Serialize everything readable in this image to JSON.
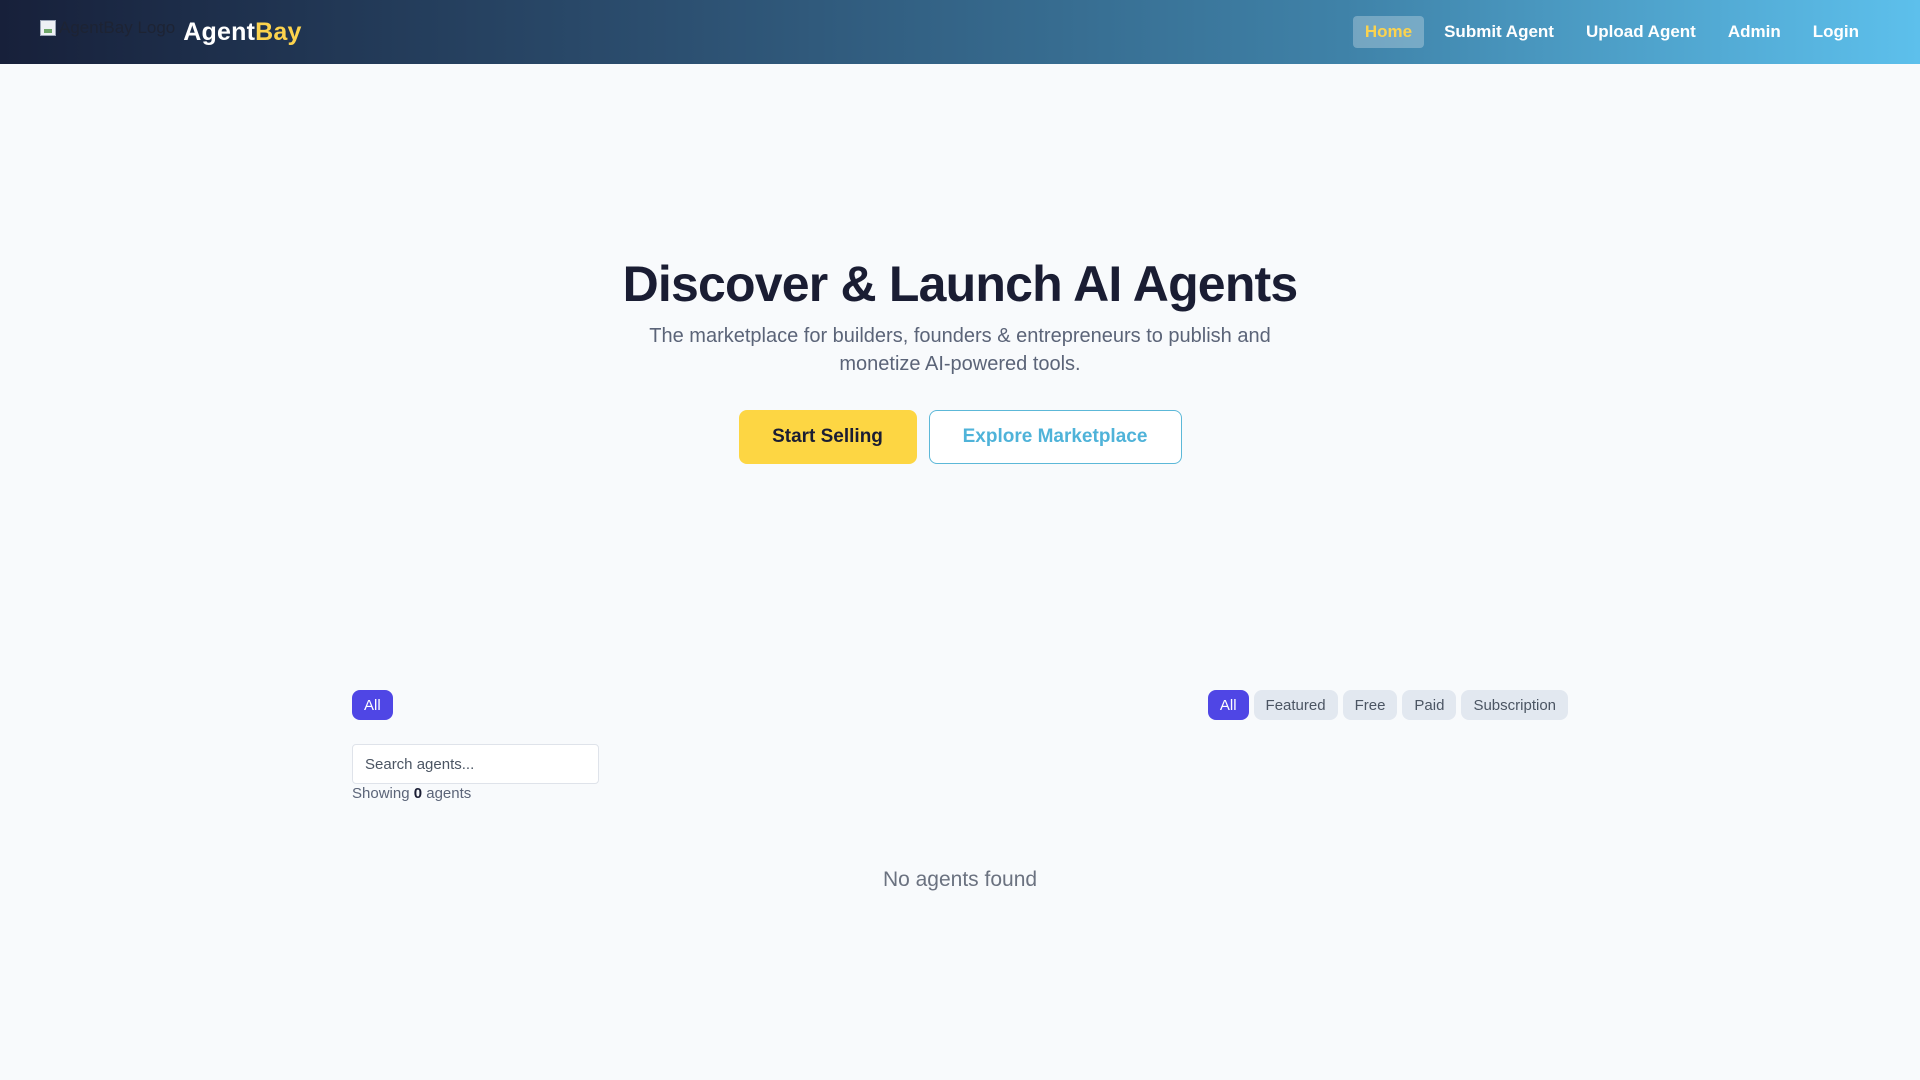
{
  "header": {
    "logo_alt": "AgentBay Logo",
    "brand_primary": "Agent",
    "brand_accent": "Bay",
    "nav": [
      {
        "label": "Home",
        "active": true
      },
      {
        "label": "Submit Agent",
        "active": false
      },
      {
        "label": "Upload Agent",
        "active": false
      },
      {
        "label": "Admin",
        "active": false
      },
      {
        "label": "Login",
        "active": false
      }
    ]
  },
  "hero": {
    "title": "Discover & Launch AI Agents",
    "subtitle": "The marketplace for builders, founders & entrepreneurs to publish and monetize AI-powered tools.",
    "primary_cta": "Start Selling",
    "secondary_cta": "Explore Marketplace"
  },
  "filters": {
    "categories": [
      {
        "label": "All",
        "active": true
      }
    ],
    "types": [
      {
        "label": "All",
        "active": true
      },
      {
        "label": "Featured",
        "active": false
      },
      {
        "label": "Free",
        "active": false
      },
      {
        "label": "Paid",
        "active": false
      },
      {
        "label": "Subscription",
        "active": false
      }
    ]
  },
  "search": {
    "placeholder": "Search agents...",
    "value": ""
  },
  "results": {
    "prefix": "Showing",
    "count": "0",
    "suffix": "agents",
    "empty_message": "No agents found"
  },
  "colors": {
    "accent_yellow": "#fdd643",
    "active_pill": "#4f46e5",
    "outline_blue": "#4fb3d9"
  }
}
